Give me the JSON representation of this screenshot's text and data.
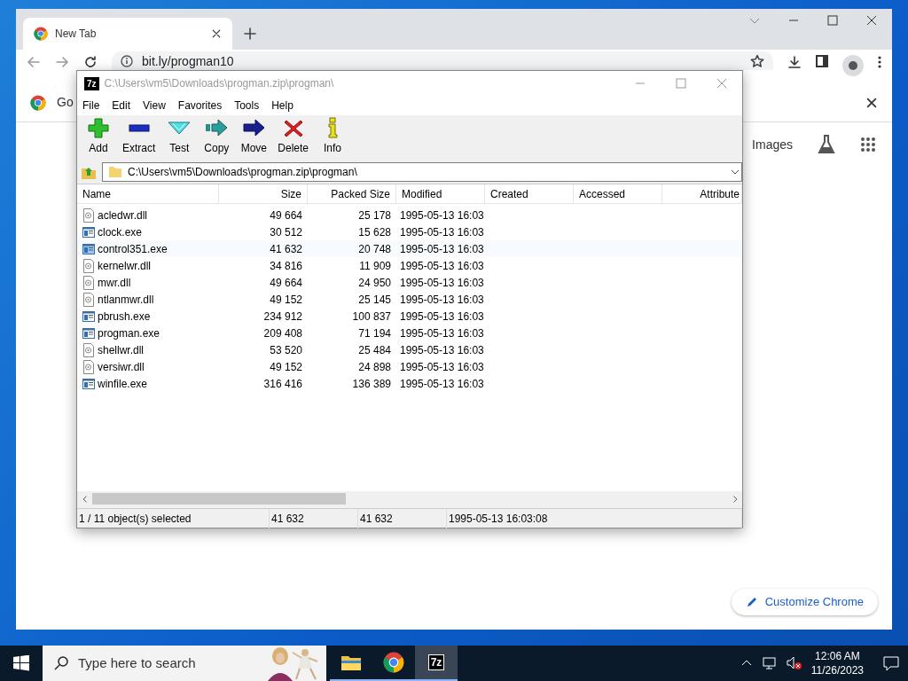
{
  "browser": {
    "tab": {
      "title": "New Tab"
    },
    "address": "bit.ly/progman10",
    "bookmark_text": "Go",
    "links": [
      "Images"
    ],
    "customize_button": "Customize Chrome"
  },
  "archiver": {
    "logo": "7z",
    "title": "C:\\Users\\vm5\\Downloads\\progman.zip\\progman\\",
    "menu": [
      "File",
      "Edit",
      "View",
      "Favorites",
      "Tools",
      "Help"
    ],
    "toolbar": [
      {
        "kind": "add",
        "label": "Add"
      },
      {
        "kind": "extract",
        "label": "Extract"
      },
      {
        "kind": "test",
        "label": "Test"
      },
      {
        "kind": "copy",
        "label": "Copy"
      },
      {
        "kind": "move",
        "label": "Move"
      },
      {
        "kind": "delete",
        "label": "Delete"
      },
      {
        "kind": "info",
        "label": "Info"
      }
    ],
    "path": "C:\\Users\\vm5\\Downloads\\progman.zip\\progman\\",
    "columns": [
      "Name",
      "Size",
      "Packed Size",
      "Modified",
      "Created",
      "Accessed",
      "Attribute"
    ],
    "rows": [
      {
        "kind": "dll",
        "name": "acledwr.dll",
        "size": "49 664",
        "packed": "25 178",
        "modified": "1995-05-13 16:03",
        "selected": false
      },
      {
        "kind": "exe",
        "name": "clock.exe",
        "size": "30 512",
        "packed": "15 628",
        "modified": "1995-05-13 16:03",
        "selected": false
      },
      {
        "kind": "exe",
        "name": "control351.exe",
        "size": "41 632",
        "packed": "20 748",
        "modified": "1995-05-13 16:03",
        "selected": true
      },
      {
        "kind": "dll",
        "name": "kernelwr.dll",
        "size": "34 816",
        "packed": "11 909",
        "modified": "1995-05-13 16:03",
        "selected": false
      },
      {
        "kind": "dll",
        "name": "mwr.dll",
        "size": "49 664",
        "packed": "24 950",
        "modified": "1995-05-13 16:03",
        "selected": false
      },
      {
        "kind": "dll",
        "name": "ntlanmwr.dll",
        "size": "49 152",
        "packed": "25 145",
        "modified": "1995-05-13 16:03",
        "selected": false
      },
      {
        "kind": "exe",
        "name": "pbrush.exe",
        "size": "234 912",
        "packed": "100 837",
        "modified": "1995-05-13 16:03",
        "selected": false
      },
      {
        "kind": "exe",
        "name": "progman.exe",
        "size": "209 408",
        "packed": "71 194",
        "modified": "1995-05-13 16:03",
        "selected": false
      },
      {
        "kind": "dll",
        "name": "shellwr.dll",
        "size": "53 520",
        "packed": "25 484",
        "modified": "1995-05-13 16:03",
        "selected": false
      },
      {
        "kind": "dll",
        "name": "versiwr.dll",
        "size": "49 152",
        "packed": "24 898",
        "modified": "1995-05-13 16:03",
        "selected": false
      },
      {
        "kind": "exe",
        "name": "winfile.exe",
        "size": "316 416",
        "packed": "136 389",
        "modified": "1995-05-13 16:03",
        "selected": false
      }
    ],
    "status": [
      "1 / 11 object(s) selected",
      "41 632",
      "41 632",
      "1995-05-13 16:03:08"
    ]
  },
  "taskbar": {
    "search_placeholder": "Type here to search",
    "apps": [
      {
        "kind": "folder",
        "selected": false
      },
      {
        "kind": "chrome",
        "selected": false
      },
      {
        "kind": "archiver",
        "label": "7z",
        "selected": true
      }
    ],
    "time": "12:06 AM",
    "date": "11/26/2023"
  }
}
